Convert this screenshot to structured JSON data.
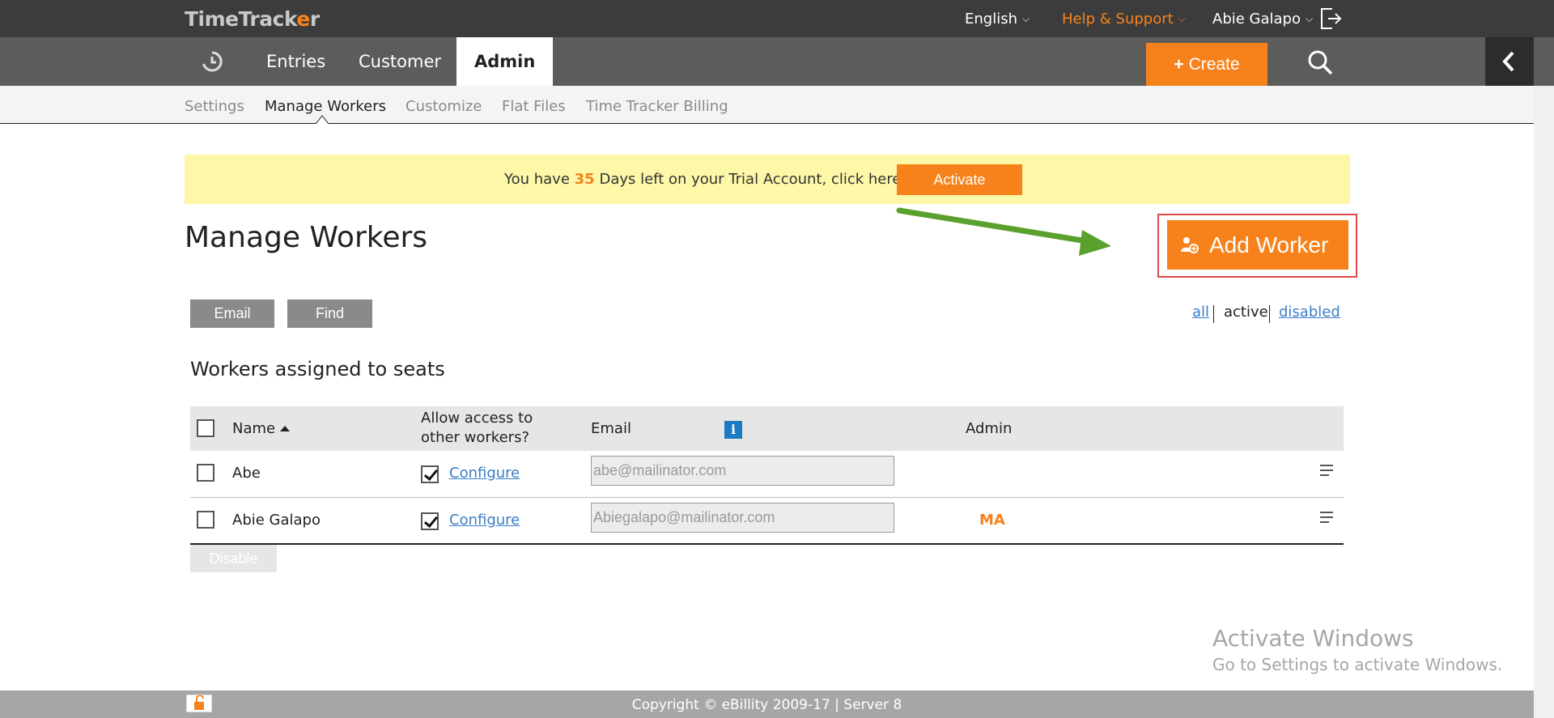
{
  "header": {
    "logo_main": "TimeTrack",
    "logo_o": "e",
    "logo_end": "r",
    "language": "English",
    "help": "Help & Support",
    "user": "Abie Galapo"
  },
  "nav": {
    "items": [
      "Entries",
      "Customer",
      "Admin"
    ],
    "active": "Admin",
    "create_label": "Create"
  },
  "subnav": {
    "items": [
      "Settings",
      "Manage Workers",
      "Customize",
      "Flat Files",
      "Time Tracker Billing"
    ],
    "active": "Manage Workers"
  },
  "trial": {
    "prefix": "You have",
    "days": "35",
    "suffix": "Days left on your Trial Account, click here to",
    "activate_label": "Activate"
  },
  "page": {
    "title": "Manage Workers",
    "add_worker_label": "Add Worker",
    "email_label": "Email",
    "find_label": "Find",
    "filters": {
      "all": "all",
      "active": "active",
      "disabled": "disabled",
      "selected": "active"
    },
    "section_title": "Workers assigned to seats",
    "disable_label": "Disable"
  },
  "table": {
    "headers": {
      "name": "Name",
      "access_line1": "Allow access to",
      "access_line2": "other workers?",
      "email": "Email",
      "admin": "Admin"
    },
    "rows": [
      {
        "name": "Abe",
        "access": true,
        "configure": "Configure",
        "email": "abe@mailinator.com",
        "admin": ""
      },
      {
        "name": "Abie Galapo",
        "access": true,
        "configure": "Configure",
        "email": "Abiegalapo@mailinator.com",
        "admin": "MA"
      }
    ]
  },
  "watermark": {
    "line1": "Activate Windows",
    "line2": "Go to Settings to activate Windows."
  },
  "footer": {
    "text": "Copyright © eBillity 2009-17  |  Server 8"
  },
  "colors": {
    "accent": "#f7821b",
    "topbar": "#3c3c3c",
    "navbar": "#5c5c5a",
    "banner": "#fdf8a8",
    "link": "#3a7ec6",
    "arrow": "#5aa02c"
  }
}
